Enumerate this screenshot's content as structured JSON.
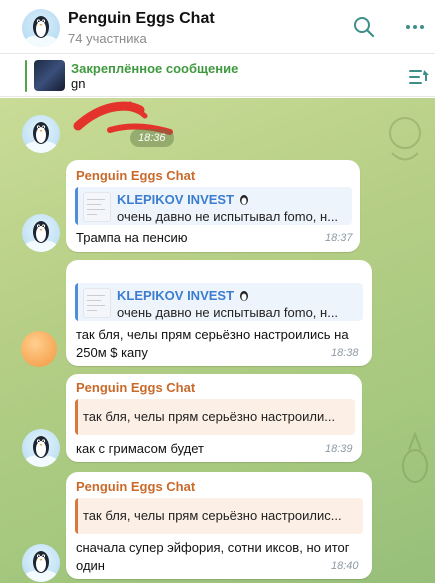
{
  "header": {
    "title": "Penguin Eggs Chat",
    "subtitle": "74 участника",
    "icons": [
      "search-icon",
      "more-icon"
    ]
  },
  "pinned": {
    "title": "Закреплённое сообщение",
    "text": "gn"
  },
  "chat": {
    "sticker_time": "18:36",
    "messages": [
      {
        "reply": {
          "name": "KLEPIKOV INVEST",
          "text": "очень давно не испытывал fomo, н..."
        },
        "sender": "Penguin Eggs Chat",
        "text": "Трампа на пенсию",
        "time": "18:37"
      },
      {
        "reply": {
          "name": "KLEPIKOV INVEST",
          "text": "очень давно не испытывал fomo, н..."
        },
        "text_line1": "так бля, челы прям серьёзно настроились на",
        "text_line2": "250м $ капу",
        "time": "18:38"
      },
      {
        "sender": "Penguin Eggs Chat",
        "reply": {
          "text": "так бля, челы прям серьёзно настроили..."
        },
        "text": "как с гримасом будет",
        "time": "18:39"
      },
      {
        "sender": "Penguin Eggs Chat",
        "reply": {
          "text": "так бля, челы прям серьёзно настроилис..."
        },
        "text_line1": "сначала супер эйфория, сотни иксов, но итог",
        "text_line2": "один",
        "time": "18:40"
      }
    ]
  },
  "colors": {
    "sender": "#c96a2b",
    "reply_name": "#3b7dd0",
    "pinned_title": "#3f9a3f",
    "chat_bg": "#b7cf86"
  }
}
